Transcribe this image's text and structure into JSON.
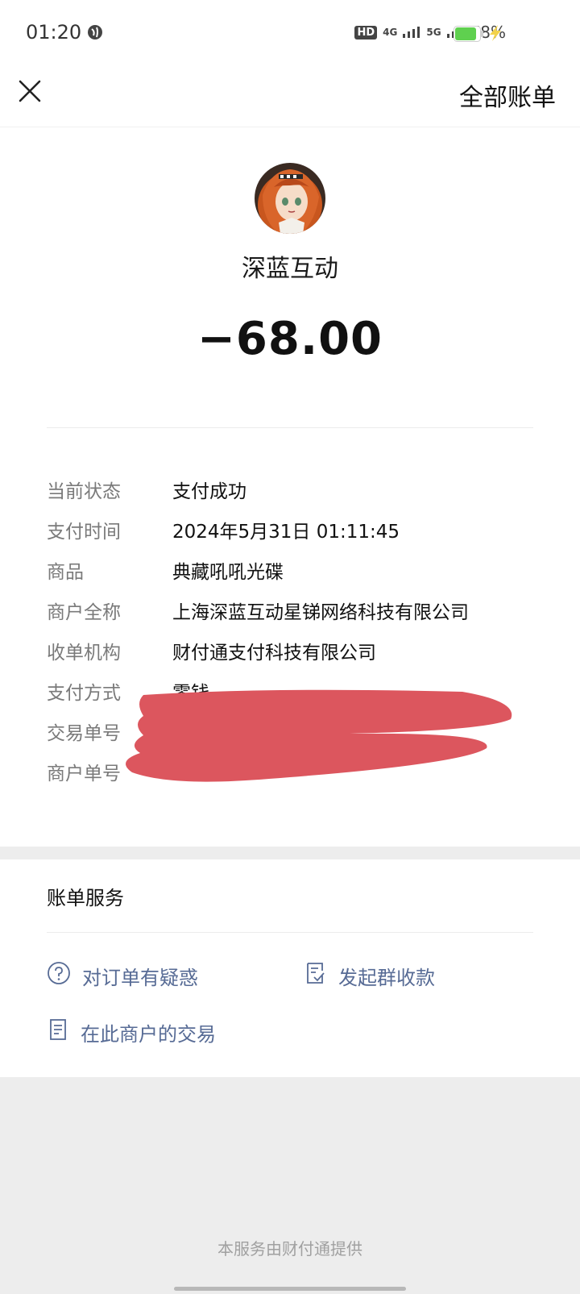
{
  "status_bar": {
    "time": "01:20",
    "hd_label": "HD",
    "net1": "4G",
    "net2": "5G",
    "battery": "78%"
  },
  "nav": {
    "close_icon": "close-icon",
    "all_bills": "全部账单"
  },
  "merchant": {
    "name": "深蓝互动",
    "amount": "−68.00"
  },
  "details": [
    {
      "label": "当前状态",
      "value": "支付成功"
    },
    {
      "label": "支付时间",
      "value": "2024年5月31日 01:11:45"
    },
    {
      "label": "商品",
      "value": "典藏吼吼光碟"
    },
    {
      "label": "商户全称",
      "value": "上海深蓝互动星锑网络科技有限公司"
    },
    {
      "label": "收单机构",
      "value": "财付通支付科技有限公司"
    },
    {
      "label": "支付方式",
      "value": "零钱"
    },
    {
      "label": "交易单号",
      "value": ""
    },
    {
      "label": "商户单号",
      "value": ""
    }
  ],
  "service": {
    "title": "账单服务",
    "links": [
      {
        "label": "对订单有疑惑",
        "icon": "question-circle-icon"
      },
      {
        "label": "发起群收款",
        "icon": "receipt-check-icon"
      },
      {
        "label": "在此商户的交易",
        "icon": "document-icon"
      }
    ]
  },
  "footer": "本服务由财付通提供",
  "colors": {
    "link": "#576b95",
    "redaction": "#dc565e",
    "background": "#ededed"
  }
}
